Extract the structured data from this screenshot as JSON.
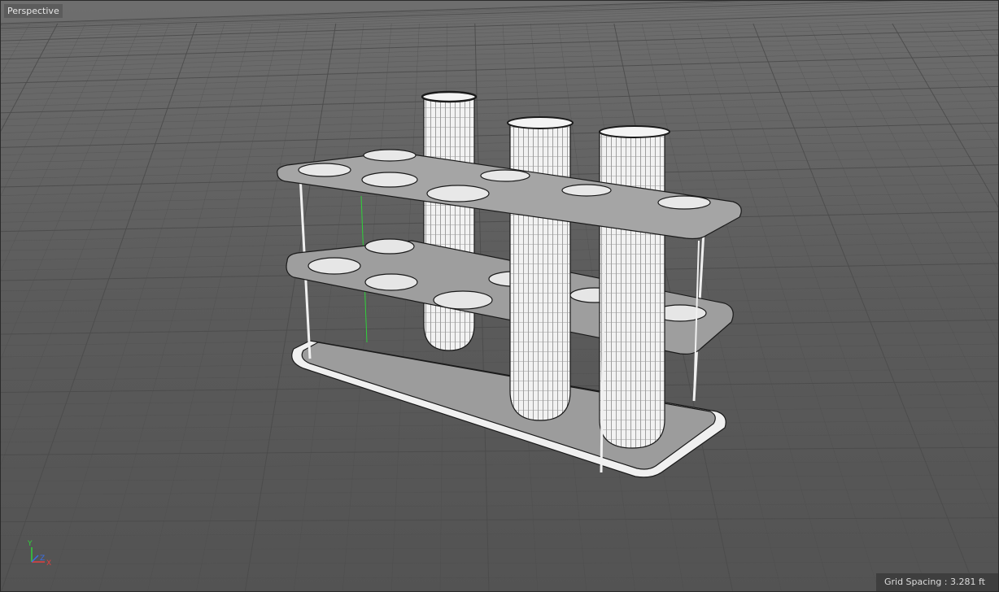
{
  "viewport": {
    "label": "Perspective",
    "grid_spacing": "Grid Spacing : 3.281 ft"
  },
  "axis_gizmo": {
    "y": "Y",
    "x": "X",
    "z": "Z"
  },
  "colors": {
    "background": "#5a5a5a",
    "grid": "#4b4b4b",
    "axis_y": "#2fd23a",
    "axis_x": "#e04040",
    "axis_z": "#3a6ee8"
  }
}
